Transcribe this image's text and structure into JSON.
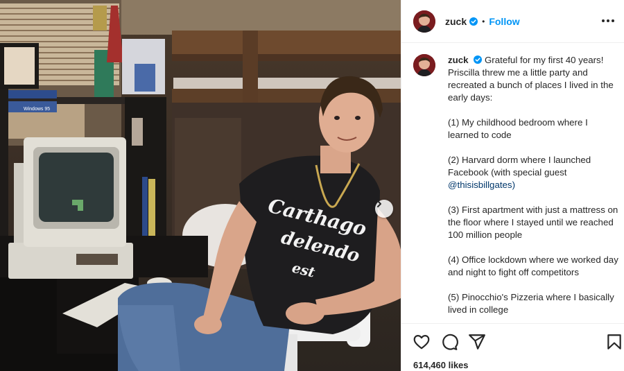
{
  "post": {
    "username": "zuck",
    "follow_label": "Follow",
    "separator": "•",
    "likes_label": "614,460 likes"
  },
  "caption": {
    "paragraphs": [
      "Grateful for my first 40 years! Priscilla threw me a little party and recreated a bunch of places I lived in the early days:",
      "(1) My childhood bedroom where I learned to code",
      "(2) Harvard dorm where I launched Facebook (with special guest",
      "(3) First apartment with just a mattress on the floor where I stayed until we reached 100 million people",
      "(4) Office lockdown where we worked day and night to fight off competitors",
      "(5) Pinocchio's Pizzeria where I basically lived in college"
    ],
    "mention": "@thisisbillgates)"
  },
  "photo": {
    "shirt_text": [
      "Carthago",
      "delendo",
      "est"
    ],
    "box_text": "Windows 95"
  },
  "icons": {
    "verified": "verified-badge-icon",
    "more": "more-options-icon",
    "next": "chevron-right-icon",
    "like": "heart-icon",
    "comment": "comment-icon",
    "share": "send-icon",
    "save": "bookmark-icon"
  },
  "colors": {
    "accent": "#0095f6",
    "mention": "#00376b",
    "text": "#262626"
  }
}
